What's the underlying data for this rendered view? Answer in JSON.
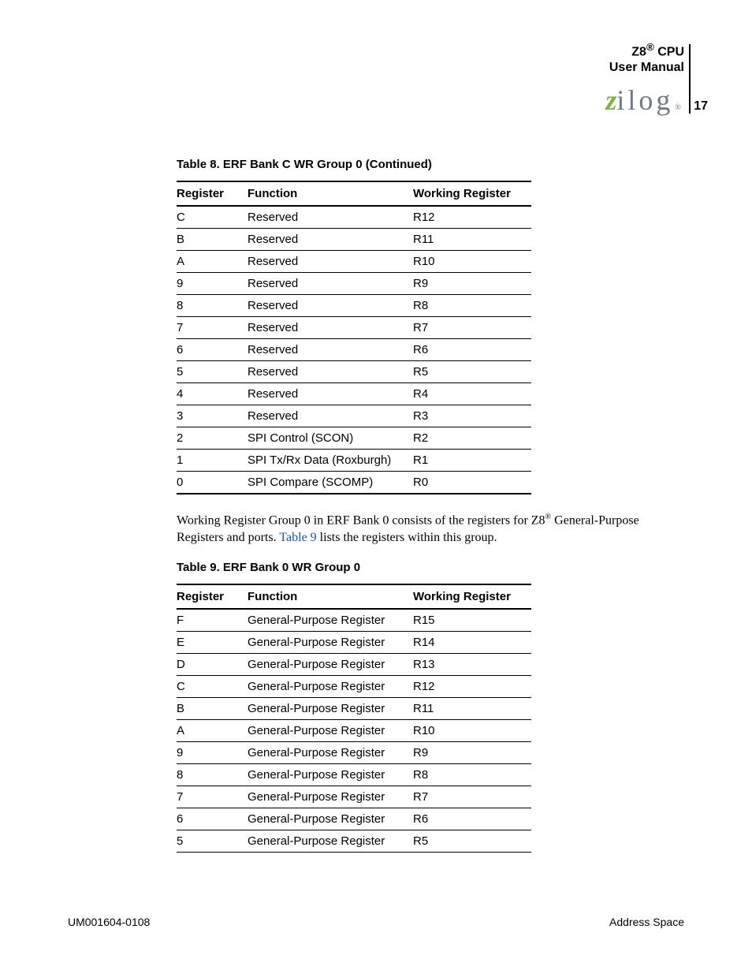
{
  "header": {
    "line1": "Z8",
    "reg": "®",
    "line1b": " CPU",
    "line2": "User Manual",
    "logo_z": "z",
    "logo_rest": "ilog",
    "logo_tm": "®",
    "page_number": "17"
  },
  "table8": {
    "caption": "Table 8. ERF Bank C WR Group 0 (Continued)",
    "headers": {
      "register": "Register",
      "function": "Function",
      "working": "Working Register"
    },
    "rows": [
      {
        "reg": "C",
        "func": "Reserved",
        "wr": "R12"
      },
      {
        "reg": "B",
        "func": "Reserved",
        "wr": "R11"
      },
      {
        "reg": "A",
        "func": "Reserved",
        "wr": "R10"
      },
      {
        "reg": "9",
        "func": "Reserved",
        "wr": "R9"
      },
      {
        "reg": "8",
        "func": "Reserved",
        "wr": "R8"
      },
      {
        "reg": "7",
        "func": "Reserved",
        "wr": "R7"
      },
      {
        "reg": "6",
        "func": "Reserved",
        "wr": "R6"
      },
      {
        "reg": "5",
        "func": "Reserved",
        "wr": "R5"
      },
      {
        "reg": "4",
        "func": "Reserved",
        "wr": "R4"
      },
      {
        "reg": "3",
        "func": "Reserved",
        "wr": "R3"
      },
      {
        "reg": "2",
        "func": "SPI Control (SCON)",
        "wr": "R2"
      },
      {
        "reg": "1",
        "func": "SPI Tx/Rx Data (Roxburgh)",
        "wr": "R1"
      },
      {
        "reg": "0",
        "func": "SPI Compare (SCOMP)",
        "wr": "R0"
      }
    ]
  },
  "paragraph": {
    "t1": "Working Register Group 0 in ERF Bank 0 consists of the registers for Z8",
    "sup": "®",
    "t2": " General-Purpose Registers and ports. ",
    "link": "Table 9",
    "t3": " lists the registers within this group."
  },
  "table9": {
    "caption": "Table 9. ERF Bank 0 WR Group 0",
    "headers": {
      "register": "Register",
      "function": "Function",
      "working": "Working Register"
    },
    "rows": [
      {
        "reg": "F",
        "func": "General-Purpose Register",
        "wr": "R15"
      },
      {
        "reg": "E",
        "func": "General-Purpose Register",
        "wr": "R14"
      },
      {
        "reg": "D",
        "func": "General-Purpose Register",
        "wr": "R13"
      },
      {
        "reg": "C",
        "func": "General-Purpose Register",
        "wr": "R12"
      },
      {
        "reg": "B",
        "func": "General-Purpose Register",
        "wr": "R11"
      },
      {
        "reg": "A",
        "func": "General-Purpose Register",
        "wr": "R10"
      },
      {
        "reg": "9",
        "func": "General-Purpose Register",
        "wr": "R9"
      },
      {
        "reg": "8",
        "func": "General-Purpose Register",
        "wr": "R8"
      },
      {
        "reg": "7",
        "func": "General-Purpose Register",
        "wr": "R7"
      },
      {
        "reg": "6",
        "func": "General-Purpose Register",
        "wr": "R6"
      },
      {
        "reg": "5",
        "func": "General-Purpose Register",
        "wr": "R5"
      }
    ]
  },
  "footer": {
    "left": "UM001604-0108",
    "right": "Address Space"
  }
}
